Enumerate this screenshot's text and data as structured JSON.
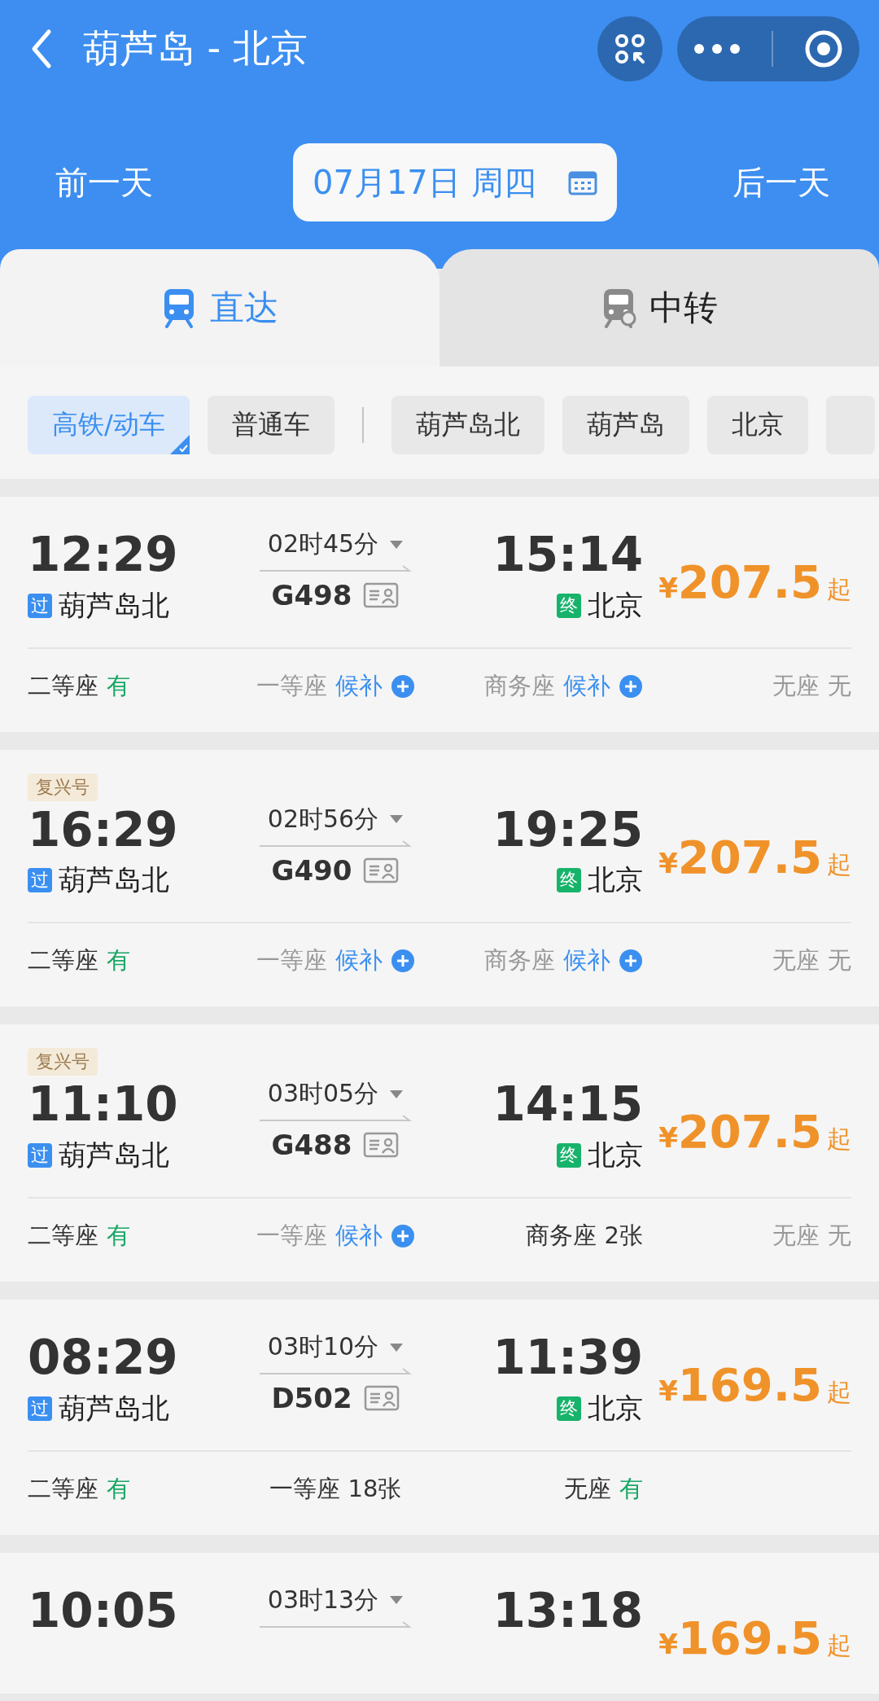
{
  "header": {
    "title": "葫芦岛 - 北京"
  },
  "date_bar": {
    "prev": "前一天",
    "date": "07月17日 周四",
    "next": "后一天"
  },
  "tabs": [
    {
      "label": "直达",
      "selected": true
    },
    {
      "label": "中转",
      "selected": false
    }
  ],
  "filters": {
    "train_types": [
      {
        "label": "高铁/动车",
        "selected": true
      },
      {
        "label": "普通车",
        "selected": false
      }
    ],
    "stations": [
      {
        "label": "葫芦岛北",
        "selected": false
      },
      {
        "label": "葫芦岛",
        "selected": false
      },
      {
        "label": "北京",
        "selected": false
      }
    ]
  },
  "trains": [
    {
      "depart": "12:29",
      "from_badge": "过",
      "from": "葫芦岛北",
      "duration": "02时45分",
      "number": "G498",
      "arrive": "15:14",
      "to_badge": "终",
      "to": "北京",
      "price": "207.5",
      "price_suffix": "起",
      "currency": "¥",
      "seats": [
        {
          "name": "二等座",
          "status": "有",
          "kind": "available"
        },
        {
          "name": "一等座",
          "status": "候补",
          "kind": "waitlist"
        },
        {
          "name": "商务座",
          "status": "候补",
          "kind": "waitlist"
        },
        {
          "name": "无座",
          "status": "无",
          "kind": "none"
        }
      ]
    },
    {
      "tag": "复兴号",
      "depart": "16:29",
      "from_badge": "过",
      "from": "葫芦岛北",
      "duration": "02时56分",
      "number": "G490",
      "arrive": "19:25",
      "to_badge": "终",
      "to": "北京",
      "price": "207.5",
      "price_suffix": "起",
      "currency": "¥",
      "seats": [
        {
          "name": "二等座",
          "status": "有",
          "kind": "available"
        },
        {
          "name": "一等座",
          "status": "候补",
          "kind": "waitlist"
        },
        {
          "name": "商务座",
          "status": "候补",
          "kind": "waitlist"
        },
        {
          "name": "无座",
          "status": "无",
          "kind": "none"
        }
      ]
    },
    {
      "tag": "复兴号",
      "depart": "11:10",
      "from_badge": "过",
      "from": "葫芦岛北",
      "duration": "03时05分",
      "number": "G488",
      "arrive": "14:15",
      "to_badge": "终",
      "to": "北京",
      "price": "207.5",
      "price_suffix": "起",
      "currency": "¥",
      "seats": [
        {
          "name": "二等座",
          "status": "有",
          "kind": "available"
        },
        {
          "name": "一等座",
          "status": "候补",
          "kind": "waitlist"
        },
        {
          "name": "商务座",
          "status": "2张",
          "kind": "count"
        },
        {
          "name": "无座",
          "status": "无",
          "kind": "none"
        }
      ]
    },
    {
      "depart": "08:29",
      "from_badge": "过",
      "from": "葫芦岛北",
      "duration": "03时10分",
      "number": "D502",
      "arrive": "11:39",
      "to_badge": "终",
      "to": "北京",
      "price": "169.5",
      "price_suffix": "起",
      "currency": "¥",
      "seats": [
        {
          "name": "二等座",
          "status": "有",
          "kind": "available"
        },
        {
          "name": "一等座",
          "status": "18张",
          "kind": "count"
        },
        {
          "name": "无座",
          "status": "有",
          "kind": "available"
        }
      ]
    },
    {
      "depart": "10:05",
      "duration": "03时13分",
      "arrive": "13:18",
      "price": "169.5",
      "price_suffix": "起",
      "currency": "¥"
    }
  ]
}
